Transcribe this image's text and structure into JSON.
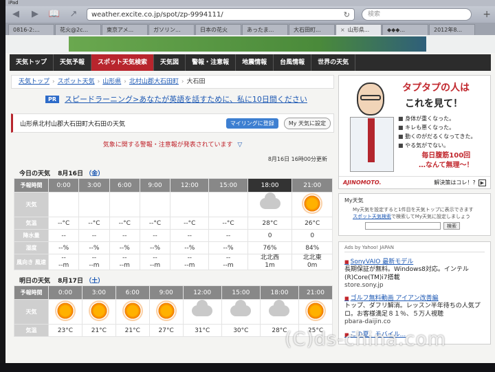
{
  "device": {
    "status_label": "iPad"
  },
  "browser": {
    "url": "weather.excite.co.jp/spot/zp-9994111/",
    "search_placeholder": "検索",
    "tabs": [
      {
        "label": "0816-2:..."
      },
      {
        "label": "花火@2c..."
      },
      {
        "label": "東京アメ..."
      },
      {
        "label": "ガソリン..."
      },
      {
        "label": "日本の花火"
      },
      {
        "label": "あったま..."
      },
      {
        "label": "大石田町..."
      },
      {
        "label": "山形県...",
        "active": true
      },
      {
        "label": "◆◆◆..."
      },
      {
        "label": "2012年8..."
      }
    ]
  },
  "nav": {
    "items": [
      {
        "label": "天気トップ"
      },
      {
        "label": "天気予報"
      },
      {
        "label": "スポット天気検索",
        "active": true
      },
      {
        "label": "天気図"
      },
      {
        "label": "警報・注意報"
      },
      {
        "label": "地震情報"
      },
      {
        "label": "台風情報"
      },
      {
        "label": "世界の天気"
      }
    ]
  },
  "breadcrumb": [
    "天気トップ",
    "スポット天気",
    "山形県",
    "北村山郡大石田町",
    "大石田"
  ],
  "pr": {
    "badge": "PR",
    "text": "スピードラーニング>あなたが英語を話すために、私に10日間ください"
  },
  "location": {
    "title": "山形県北村山郡大石田町大石田の天気",
    "mailing_btn": "マイリングに登録",
    "myweather_btn": "My 天気に設定"
  },
  "warning": {
    "text": "気象に関する警報・注意報が発表されています",
    "link": "▽"
  },
  "updated": "8月16日 16時00分更新",
  "today": {
    "label": "今日の天気",
    "date": "8月16日",
    "weekday": "（金）",
    "hours": [
      "0:00",
      "3:00",
      "6:00",
      "9:00",
      "12:00",
      "15:00",
      "18:00",
      "21:00"
    ],
    "row_labels": {
      "time": "予報時間",
      "weather": "天気",
      "temp": "気温",
      "precip": "降水量",
      "humidity": "湿度",
      "wind": "風向き 風速"
    },
    "weather": [
      "",
      "",
      "",
      "",
      "",
      "",
      "cloud-icon",
      "sun-icon"
    ],
    "temp": [
      "--°C",
      "--°C",
      "--°C",
      "--°C",
      "--°C",
      "--°C",
      "28°C",
      "26°C"
    ],
    "precip": [
      "--",
      "--",
      "--",
      "--",
      "--",
      "--",
      "0",
      "0"
    ],
    "humidity": [
      "--%",
      "--%",
      "--%",
      "--%",
      "--%",
      "--%",
      "76%",
      "84%"
    ],
    "wind_dir": [
      "--",
      "--",
      "--",
      "--",
      "--",
      "--",
      "北北西",
      "北北東"
    ],
    "wind_speed": [
      "--m",
      "--m",
      "--m",
      "--m",
      "--m",
      "--m",
      "1m",
      "0m"
    ]
  },
  "tomorrow": {
    "label": "明日の天気",
    "date": "8月17日",
    "weekday": "（土）",
    "hours": [
      "0:00",
      "3:00",
      "6:00",
      "9:00",
      "12:00",
      "15:00",
      "18:00",
      "21:00"
    ],
    "weather": [
      "sun-icon",
      "sun-icon",
      "sun-icon",
      "sun-icon",
      "cloud-icon",
      "cloud-icon",
      "cloud-icon",
      "sun-icon"
    ],
    "temp": [
      "23°C",
      "21°C",
      "21°C",
      "27°C",
      "31°C",
      "30°C",
      "28°C",
      "25°C"
    ]
  },
  "ad": {
    "headline1": "タプタプの人は",
    "headline2": "これを見て！",
    "bullets": [
      "身体が重くなった。",
      "キレも悪くなった。",
      "動くのがだるくなってきた。",
      "やる気がでない。"
    ],
    "cta1": "毎日腹筋100回",
    "cta2": "…なんて無理～！",
    "brand": "AJINOMOTO.",
    "solve": "解決策はコレ！?"
  },
  "mytenki": {
    "title": "My天気",
    "desc1": "My天気を設定すると1件目を天気トップに表示できます",
    "link": "スポット天気検索",
    "desc2": "で検索してMy天気に設定しましょう",
    "search_btn": "検索"
  },
  "yahoo": {
    "title": "Ads by Yahoo! JAPAN",
    "ads": [
      {
        "title": "SonyVAIO 最新モデル",
        "desc": "長期保証が無料。Windows8対応。インテル(R)Core(TM)i7搭載",
        "url": "store.sony.jp"
      },
      {
        "title": "ゴルフ無料動画 アイアン改善編",
        "desc": "トップ、ダフリ解消。レッスン半年待ちの人気プロ。お客様満足８１％、５万人視聴",
        "url": "pbara-daijin.co"
      },
      {
        "title": "この夏、モバイル..."
      }
    ]
  },
  "watermark": "(C)ds-china.com"
}
